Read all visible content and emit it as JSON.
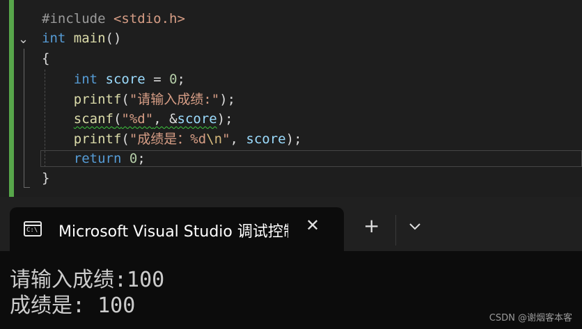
{
  "editor": {
    "lines": [
      {
        "segments": [
          {
            "t": "#include ",
            "c": "pp"
          },
          {
            "t": "<stdio.h>",
            "c": "str"
          }
        ]
      },
      {
        "segments": [
          {
            "t": "int",
            "c": "kw"
          },
          {
            "t": " ",
            "c": ""
          },
          {
            "t": "main",
            "c": "fn"
          },
          {
            "t": "()",
            "c": ""
          }
        ]
      },
      {
        "segments": [
          {
            "t": "{",
            "c": ""
          }
        ]
      },
      {
        "segments": [
          {
            "t": "",
            "c": ""
          }
        ]
      },
      {
        "segments": [
          {
            "t": "    ",
            "c": ""
          },
          {
            "t": "int",
            "c": "kw"
          },
          {
            "t": " ",
            "c": ""
          },
          {
            "t": "score",
            "c": "var"
          },
          {
            "t": " = ",
            "c": ""
          },
          {
            "t": "0",
            "c": "num"
          },
          {
            "t": ";",
            "c": ""
          }
        ]
      },
      {
        "segments": [
          {
            "t": "    ",
            "c": ""
          },
          {
            "t": "printf",
            "c": "fn"
          },
          {
            "t": "(",
            "c": ""
          },
          {
            "t": "\"请输入成绩:\"",
            "c": "str"
          },
          {
            "t": ");",
            "c": ""
          }
        ]
      },
      {
        "segments": [
          {
            "t": "    ",
            "c": ""
          },
          {
            "t": "scanf",
            "c": "fn squig"
          },
          {
            "t": "(",
            "c": "squig"
          },
          {
            "t": "\"%d\"",
            "c": "str squig"
          },
          {
            "t": ", &",
            "c": "squig"
          },
          {
            "t": "score",
            "c": "var squig"
          },
          {
            "t": ");",
            "c": ""
          }
        ]
      },
      {
        "segments": [
          {
            "t": "    ",
            "c": ""
          },
          {
            "t": "printf",
            "c": "fn"
          },
          {
            "t": "(",
            "c": ""
          },
          {
            "t": "\"成绩是：%d",
            "c": "str"
          },
          {
            "t": "\\n",
            "c": "esc"
          },
          {
            "t": "\"",
            "c": "str"
          },
          {
            "t": ", ",
            "c": ""
          },
          {
            "t": "score",
            "c": "var"
          },
          {
            "t": ");",
            "c": ""
          }
        ]
      },
      {
        "segments": [
          {
            "t": "    ",
            "c": ""
          },
          {
            "t": "return",
            "c": "kw"
          },
          {
            "t": " ",
            "c": ""
          },
          {
            "t": "0",
            "c": "num"
          },
          {
            "t": ";",
            "c": ""
          }
        ]
      },
      {
        "segments": [
          {
            "t": "}",
            "c": ""
          }
        ]
      }
    ]
  },
  "terminal": {
    "tab_title": "Microsoft Visual Studio 调试控制台",
    "icon_text": "C:\\",
    "close_glyph": "✕",
    "new_tab_glyph": "+",
    "output": [
      "请输入成绩:100",
      "成绩是: 100"
    ]
  },
  "watermark": "CSDN @谢烟客本客"
}
